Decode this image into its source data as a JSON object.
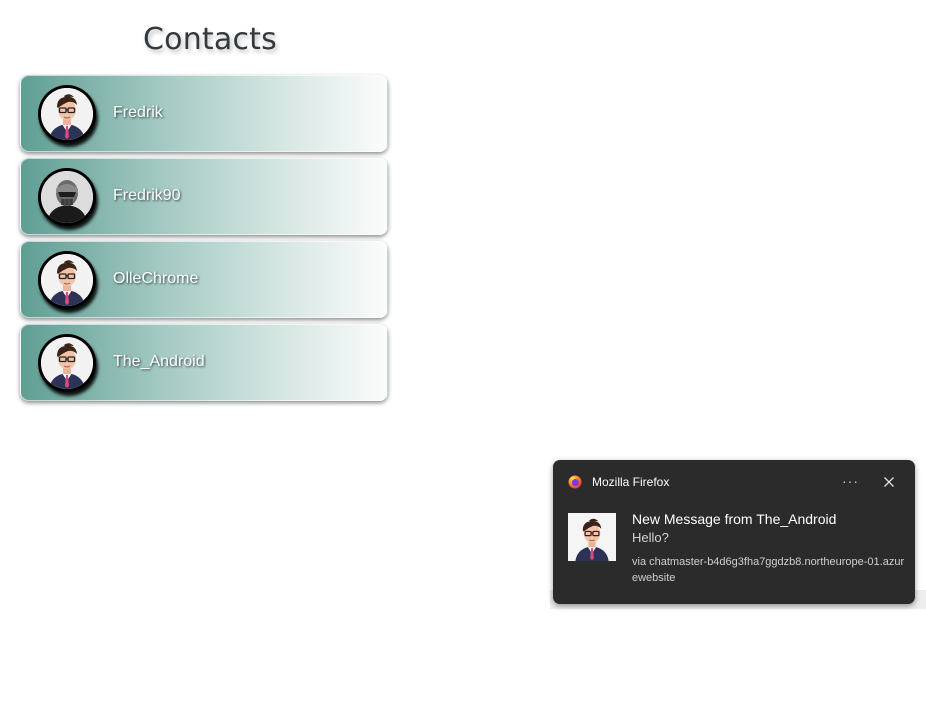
{
  "page": {
    "title": "Contacts"
  },
  "contacts": [
    {
      "name": "Fredrik",
      "avatar": "businessman-avatar-icon"
    },
    {
      "name": "Fredrik90",
      "avatar": "masked-villain-avatar-icon"
    },
    {
      "name": "OlleChrome",
      "avatar": "businessman-avatar-icon"
    },
    {
      "name": "The_Android",
      "avatar": "businessman-avatar-icon"
    }
  ],
  "notification": {
    "app_name": "Mozilla Firefox",
    "app_icon": "firefox-icon",
    "more_label": "···",
    "close_icon": "close-icon",
    "title": "New Message from The_Android",
    "body": "Hello?",
    "via": "via chatmaster-b4d6g3fha7ggdzb8.northeurope-01.azurewebsite"
  },
  "colors": {
    "gradient_start": "#5f9e93",
    "gradient_end": "#fbfcfc",
    "notification_bg": "#2b2b2b"
  }
}
